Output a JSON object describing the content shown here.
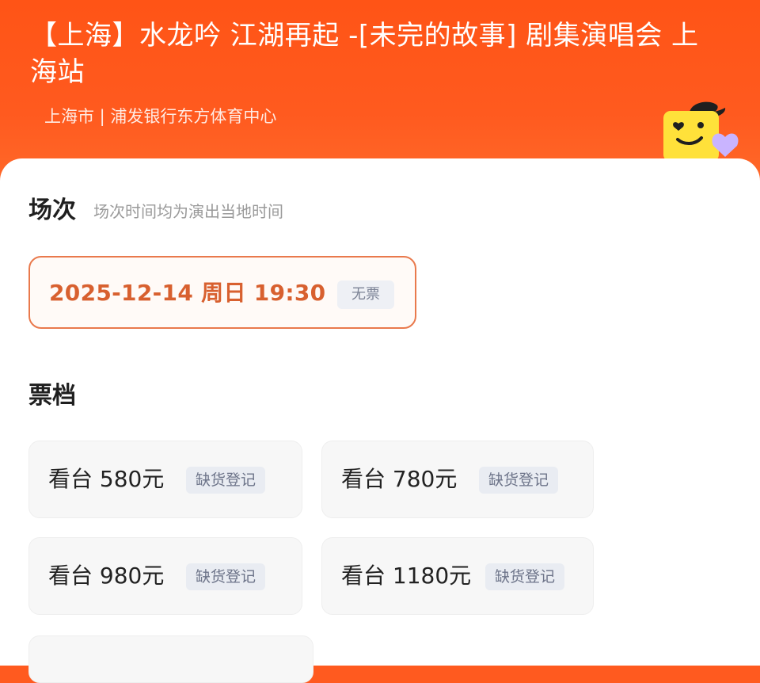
{
  "event": {
    "title": "【上海】水龙吟 江湖再起 -[未完的故事] 剧集演唱会 上海站",
    "venue": "上海市 | 浦发银行东方体育中心"
  },
  "session": {
    "heading": "场次",
    "note": "场次时间均为演出当地时间",
    "options": [
      {
        "datetime": "2025-12-14  周日 19:30",
        "status": "无票"
      }
    ]
  },
  "tiers": {
    "heading": "票档",
    "items": [
      {
        "name": "看台 580元",
        "status": "缺货登记"
      },
      {
        "name": "看台 780元",
        "status": "缺货登记"
      },
      {
        "name": "看台 980元",
        "status": "缺货登记"
      },
      {
        "name": "看台 1180元",
        "status": "缺货登记"
      }
    ]
  },
  "colors": {
    "brand": "#ff5a1f",
    "selected_border": "#e9794c",
    "selected_text": "#d8602f",
    "mascot": "#ffe13a",
    "heart": "#c9b4ff"
  },
  "icons": {
    "mascot": "smiling-yellow-mascot-with-hat",
    "heart": "heart-icon"
  }
}
